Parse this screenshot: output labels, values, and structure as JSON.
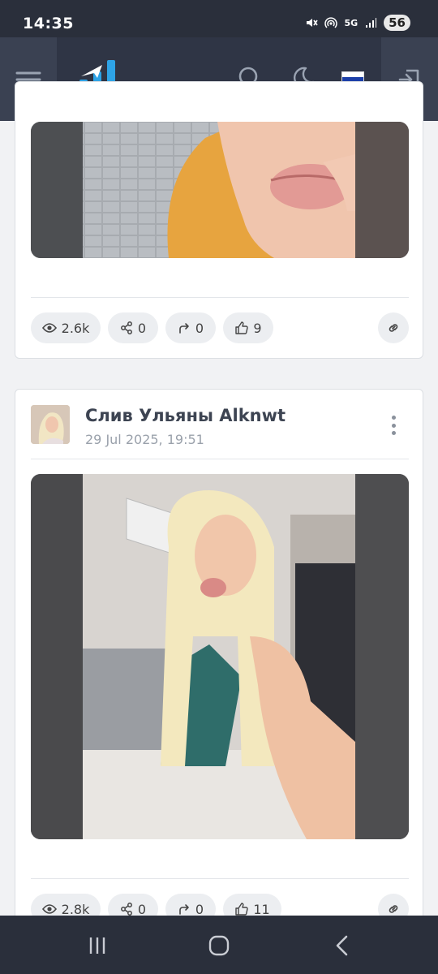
{
  "status_bar": {
    "time": "14:35",
    "network": "5G",
    "battery": "56",
    "icons": [
      "mute-icon",
      "hotspot-icon",
      "network-5g-icon",
      "signal-icon",
      "battery-icon"
    ]
  },
  "topnav": {
    "icons": [
      "menu-icon",
      "logo-icon",
      "search-icon",
      "moon-icon",
      "flag-ru-icon",
      "login-icon"
    ],
    "flag_colors": [
      "#ffffff",
      "#1c3fa8",
      "#d52b1e"
    ]
  },
  "posts": [
    {
      "photo": "post-photo-lips",
      "stats": {
        "views": "2.6k",
        "shares": "0",
        "reposts": "0",
        "likes": "9"
      }
    },
    {
      "author": "Слив Ульяны Alknwt",
      "date": "29 Jul 2025, 19:51",
      "photo": "post-photo-selfie",
      "stats": {
        "views": "2.8k",
        "shares": "0",
        "reposts": "0",
        "likes": "11"
      }
    }
  ],
  "bottom_nav": {
    "icons": [
      "recent-apps-icon",
      "home-icon",
      "back-icon"
    ]
  },
  "colors": {
    "nav_bg": "#2f3545",
    "accent_logo": "#2ea3e6",
    "card_bg": "#ffffff",
    "page_bg": "#f1f2f4"
  }
}
